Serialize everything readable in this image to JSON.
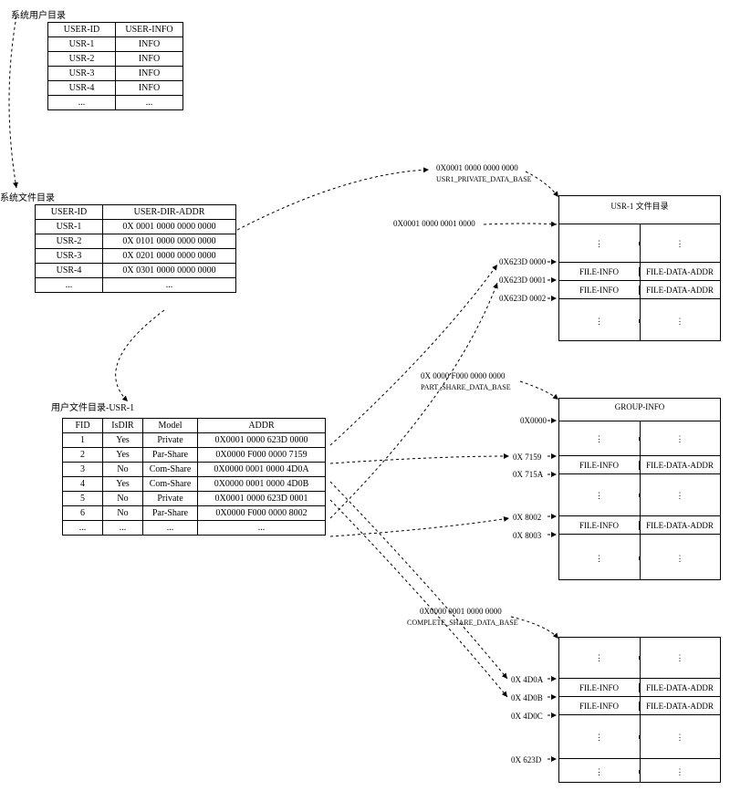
{
  "titles": {
    "user_dir": "系统用户目录",
    "sys_file_dir": "系统文件目录",
    "usr1_file_dir": "用户文件目录-USR-1",
    "usr1_block": "USR-1 文件目录",
    "group_info": "GROUP-INFO"
  },
  "user_dir": {
    "headers": [
      "USER-ID",
      "USER-INFO"
    ],
    "rows": [
      [
        "USR-1",
        "INFO"
      ],
      [
        "USR-2",
        "INFO"
      ],
      [
        "USR-3",
        "INFO"
      ],
      [
        "USR-4",
        "INFO"
      ],
      [
        "...",
        "..."
      ]
    ]
  },
  "sys_file_dir": {
    "headers": [
      "USER-ID",
      "USER-DIR-ADDR"
    ],
    "rows": [
      [
        "USR-1",
        "0X 0001 0000 0000 0000"
      ],
      [
        "USR-2",
        "0X 0101 0000 0000 0000"
      ],
      [
        "USR-3",
        "0X 0201 0000 0000 0000"
      ],
      [
        "USR-4",
        "0X 0301 0000 0000 0000"
      ],
      [
        "...",
        "..."
      ]
    ]
  },
  "usr1_file_dir": {
    "headers": [
      "FID",
      "IsDIR",
      "Model",
      "ADDR"
    ],
    "rows": [
      [
        "1",
        "Yes",
        "Private",
        "0X0001 0000 623D 0000"
      ],
      [
        "2",
        "Yes",
        "Par-Share",
        "0X0000 F000 0000 7159"
      ],
      [
        "3",
        "No",
        "Com-Share",
        "0X0000 0001 0000 4D0A"
      ],
      [
        "4",
        "Yes",
        "Com-Share",
        "0X0000 0001 0000 4D0B"
      ],
      [
        "5",
        "No",
        "Private",
        "0X0001 0000 623D 0001"
      ],
      [
        "6",
        "No",
        "Par-Share",
        "0X0000 F000 0000 8002"
      ],
      [
        "...",
        "...",
        "...",
        "..."
      ]
    ]
  },
  "addresses": {
    "usr1_private_base_hex": "0X0001 0000 0000 0000",
    "usr1_private_base_lbl": "USR1_PRIVATE_DATA_BASE",
    "usr1_private_off": "0X0001 0000 0001 0000",
    "usr1_x623d_0": "0X623D 0000",
    "usr1_x623d_1": "0X623D 0001",
    "usr1_x623d_2": "0X623D 0002",
    "part_share_base_hex": "0X 0000 F000 0000 0000",
    "part_share_base_lbl": "PART_SHARE_DATA_BASE",
    "ps_0": "0X0000",
    "ps_7159": "0X 7159",
    "ps_715a": "0X 715A",
    "ps_8002": "0X 8002",
    "ps_8003": "0X 8003",
    "complete_share_base_hex": "0X0000 0001 0000 0000",
    "complete_share_base_lbl": "COMPLETE_SHARE_DATA_BASE",
    "cs_4d0a": "0X 4D0A",
    "cs_4d0b": "0X 4D0B",
    "cs_4d0c": "0X 4D0C",
    "cs_623d": "0X 623D"
  },
  "block_cells": {
    "file_info": "FILE-INFO",
    "file_data_addr": "FILE-DATA-ADDR"
  }
}
